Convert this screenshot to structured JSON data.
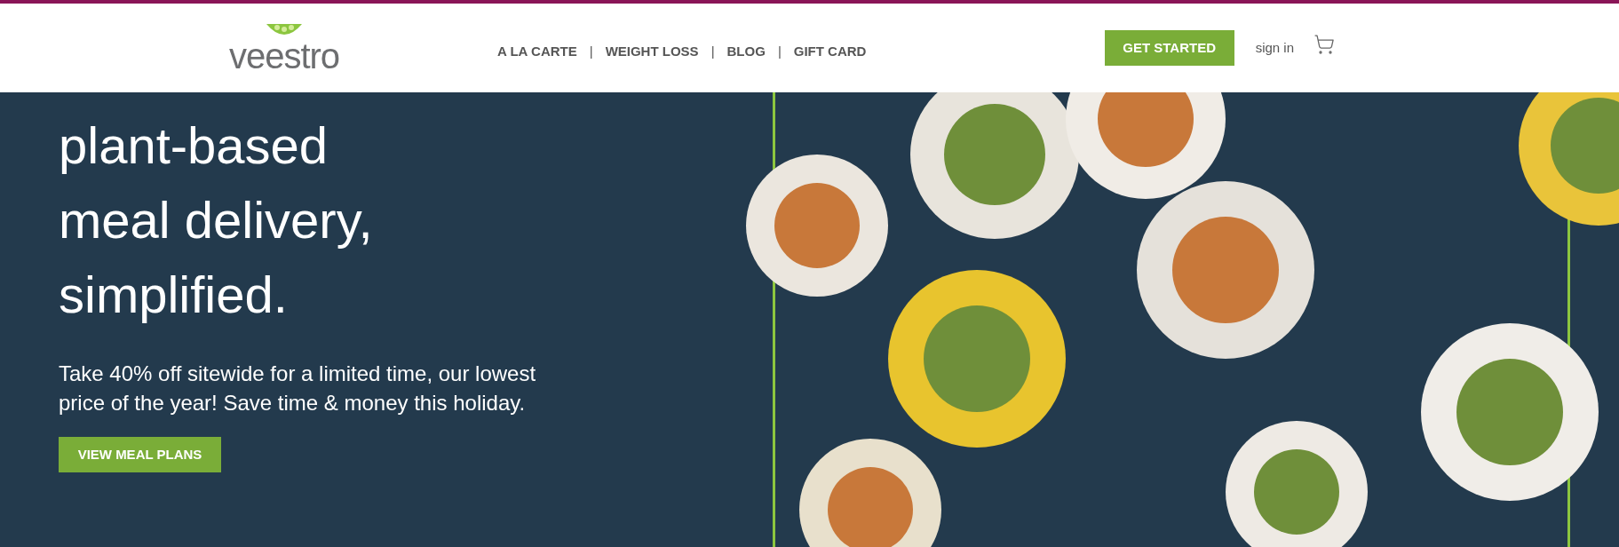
{
  "header": {
    "logo": "veestro",
    "nav": [
      {
        "label": "A LA CARTE"
      },
      {
        "label": "WEIGHT LOSS"
      },
      {
        "label": "BLOG"
      },
      {
        "label": "GIFT CARD"
      }
    ],
    "separators": [
      "|",
      "|",
      "|"
    ],
    "cta": "GET STARTED",
    "sign_in": "sign in"
  },
  "hero": {
    "headline": [
      "plant-based",
      "meal delivery,",
      "simplified."
    ],
    "text": "Take 40% off sitewide for a limited time, our lowest price of the year! Save time & money this holiday.",
    "button": "VIEW MEAL PLANS"
  }
}
